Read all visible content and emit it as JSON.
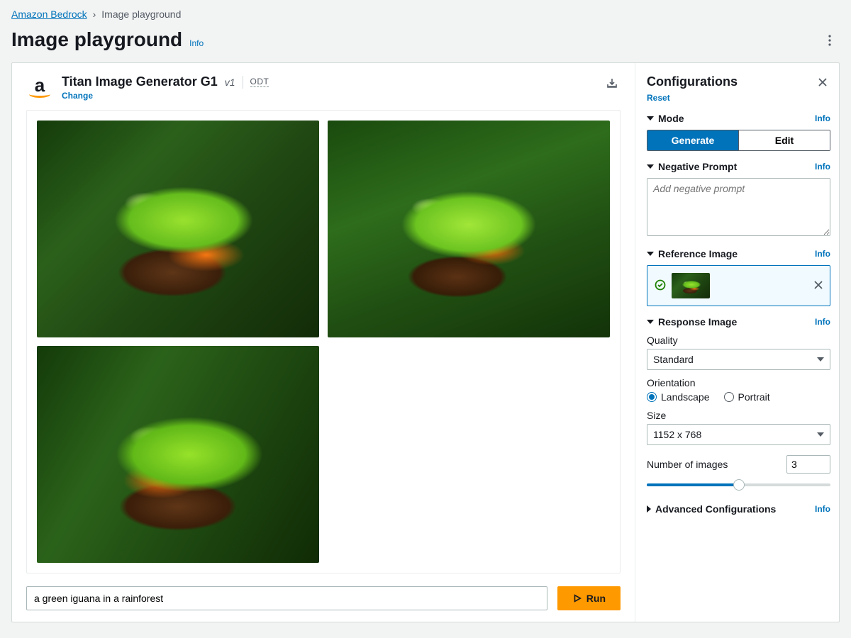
{
  "breadcrumb": {
    "root": "Amazon Bedrock",
    "current": "Image playground"
  },
  "header": {
    "title": "Image playground",
    "info": "Info"
  },
  "model": {
    "name": "Titan Image Generator G1",
    "version": "v1",
    "badge": "ODT",
    "change": "Change"
  },
  "prompt": {
    "value": "a green iguana in a rainforest",
    "run": "Run"
  },
  "config": {
    "title": "Configurations",
    "reset": "Reset",
    "info": "Info",
    "mode": {
      "label": "Mode",
      "generate": "Generate",
      "edit": "Edit"
    },
    "negative": {
      "label": "Negative Prompt",
      "placeholder": "Add negative prompt"
    },
    "reference": {
      "label": "Reference Image"
    },
    "response": {
      "label": "Response Image",
      "quality_label": "Quality",
      "quality_value": "Standard",
      "orientation_label": "Orientation",
      "landscape": "Landscape",
      "portrait": "Portrait",
      "size_label": "Size",
      "size_value": "1152 x 768",
      "num_label": "Number of images",
      "num_value": "3",
      "slider_percent": 50
    },
    "advanced": {
      "label": "Advanced Configurations"
    }
  }
}
